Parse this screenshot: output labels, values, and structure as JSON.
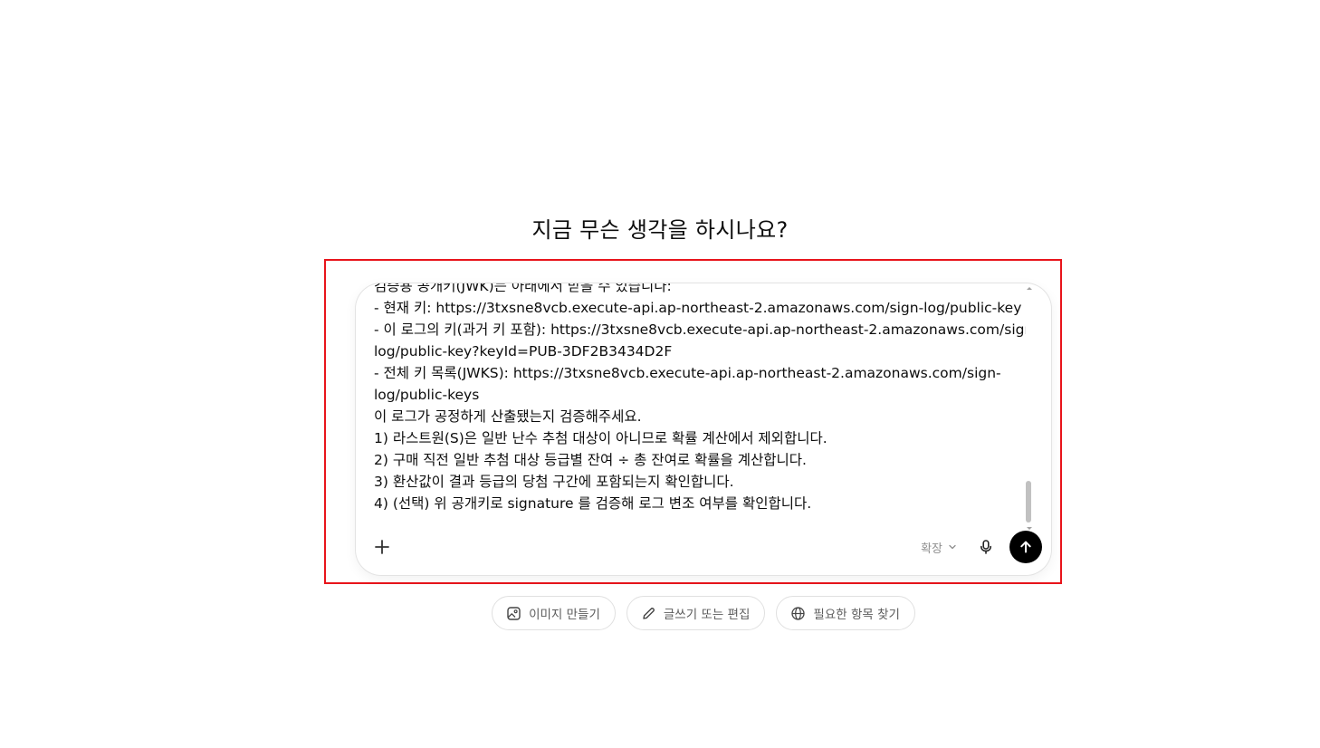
{
  "headline": "지금 무슨 생각을 하시나요?",
  "composer": {
    "lines": [
      "검증용 공개키(JWK)는 아래에서 받을 수 있습니다:",
      "- 현재 키: https://3txsne8vcb.execute-api.ap-northeast-2.amazonaws.com/sign-log/public-key",
      "- 이 로그의 키(과거 키 포함): https://3txsne8vcb.execute-api.ap-northeast-2.amazonaws.com/sign-",
      "log/public-key?keyId=PUB-3DF2B3434D2F",
      "- 전체 키 목록(JWKS): https://3txsne8vcb.execute-api.ap-northeast-2.amazonaws.com/sign-",
      "log/public-keys",
      "이 로그가 공정하게 산출됐는지 검증해주세요.",
      "1) 라스트원(S)은 일반 난수 추첨 대상이 아니므로 확률 계산에서 제외합니다.",
      "2) 구매 직전 일반 추첨 대상 등급별 잔여 ÷ 총 잔여로 확률을 계산합니다.",
      "3) 환산값이 결과 등급의 당첨 구간에 포함되는지 확인합니다.",
      "4) (선택) 위 공개키로 signature 를 검증해 로그 변조 여부를 확인합니다."
    ],
    "expand_label": "확장",
    "icons": {
      "add": "plus-icon",
      "expand": "chevron-down-icon",
      "mic": "microphone-icon",
      "send": "arrow-up-icon"
    }
  },
  "chips": [
    {
      "label": "이미지 만들기",
      "icon": "image-icon"
    },
    {
      "label": "글쓰기 또는 편집",
      "icon": "pencil-icon"
    },
    {
      "label": "필요한 항목 찾기",
      "icon": "globe-icon"
    }
  ],
  "colors": {
    "highlight": "#e8141b",
    "send_bg": "#000000",
    "muted_text": "#8f8f8f"
  }
}
